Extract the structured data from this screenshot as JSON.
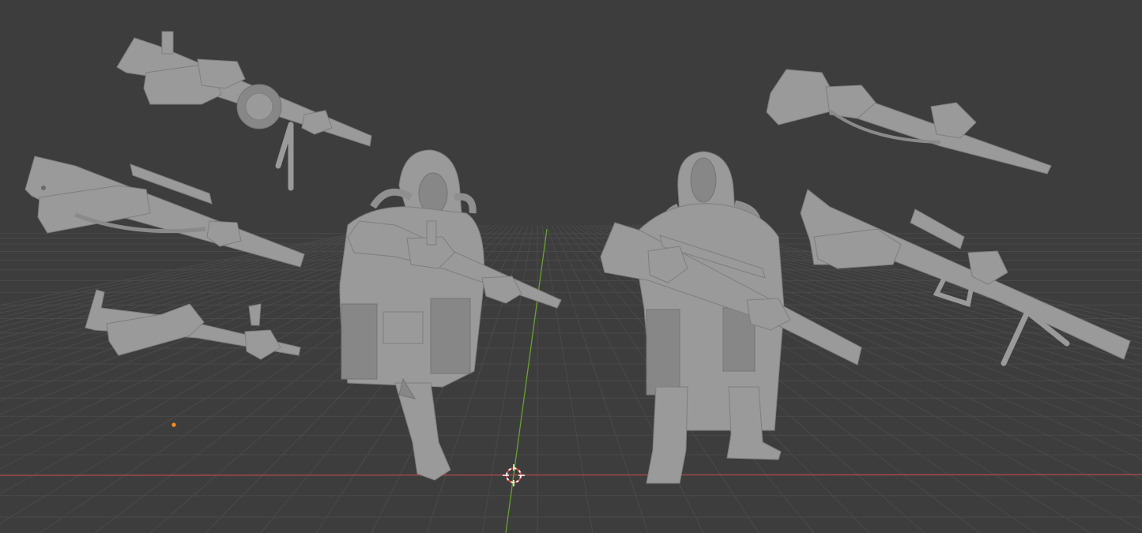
{
  "viewport": {
    "background_color": "#3d3d3d",
    "grid_line_color": "#4a4a4a",
    "x_axis_color": "#b34848",
    "y_axis_color": "#6aa034",
    "model_color": "#9a9a9a",
    "model_shadow_color": "#7d7d7d",
    "origin_marker_color": "#ff8c1a",
    "cursor_color": "#ffffff",
    "cursor_accent_color": "#d24a3a"
  },
  "scene": {
    "figures": [
      {
        "name": "hooded-soldier-gasmask-rifle"
      },
      {
        "name": "hooded-soldier-sniper-rifle"
      }
    ],
    "weapon_arms_left": [
      {
        "name": "lmg-drum-bipod-arms"
      },
      {
        "name": "scoped-rifle-arms"
      },
      {
        "name": "smg-arms"
      }
    ],
    "weapon_arms_right": [
      {
        "name": "rifle-sling-arms"
      },
      {
        "name": "lmg-bipod-arms"
      }
    ]
  }
}
